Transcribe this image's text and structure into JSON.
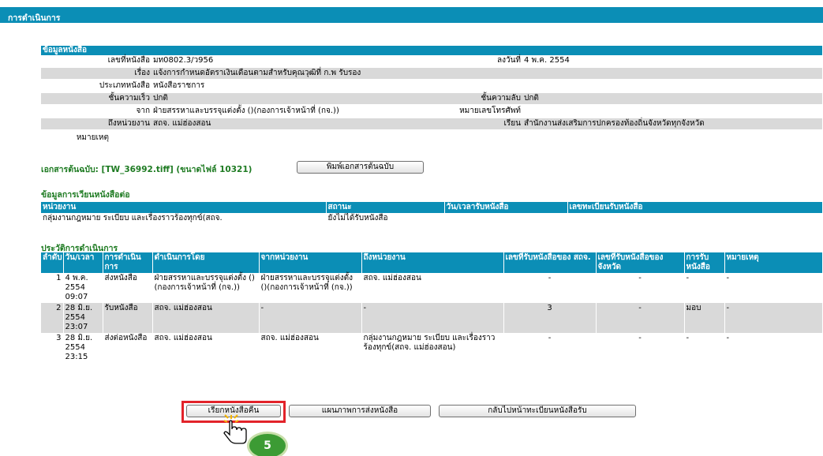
{
  "header": {
    "title": "การดำเนินการ"
  },
  "doc_info": {
    "section_title": "ข้อมูลหนังสือ",
    "number_label": "เลขที่หนังสือ",
    "number_value": "มท0802.3/ว956",
    "date_label": "ลงวันที่",
    "date_value": "4 พ.ค. 2554",
    "subject_label": "เรื่อง",
    "subject_value": "แจ้งการกำหนดอัตราเงินเดือนตามสำหรับคุณวุฒิที่ ก.พ รับรอง",
    "type_label": "ประเภทหนังสือ",
    "type_value": "หนังสือราชการ",
    "urgency_label": "ชั้นความเร็ว",
    "urgency_value": "ปกติ",
    "secrecy_label": "ชั้นความลับ",
    "secrecy_value": "ปกติ",
    "from_label": "จาก",
    "from_value": "ฝ่ายสรรหาและบรรจุแต่งตั้ง ()(กองการเจ้าหน้าที่ (กจ.))",
    "phone_label": "หมายเลขโทรศัพท์",
    "phone_value": "",
    "to_label": "ถึงหน่วยงาน",
    "to_value": "สถจ. แม่ฮ่องสอน",
    "attn_label": "เรียน",
    "attn_value": "สำนักงานส่งเสริมการปกครองท้องถิ่นจังหวัดทุกจังหวัด",
    "note_label": "หมายเหตุ",
    "note_value": ""
  },
  "original_doc": {
    "text": "เอกสารต้นฉบับ: [TW_36992.tiff] (ขนาดไฟล์ 10321)",
    "print_button": "พิมพ์เอกสารต้นฉบับ"
  },
  "routing": {
    "title": "ข้อมูลการเวียนหนังสือต่อ",
    "headers": [
      "หน่วยงาน",
      "สถานะ",
      "วัน/เวลารับหนังสือ",
      "เลขทะเบียนรับหนังสือ"
    ],
    "rows": [
      [
        "กลุ่มงานกฎหมาย ระเบียบ และเรื่องราวร้องทุกข์(สถจ.",
        "ยังไม่ได้รับหนังสือ",
        "",
        ""
      ]
    ]
  },
  "history": {
    "title": "ประวัติการดำเนินการ",
    "headers": [
      "ลำดับ",
      "วัน/เวลา",
      "การดำเนินการ",
      "ดำเนินการโดย",
      "จากหน่วยงาน",
      "ถึงหน่วยงาน",
      "เลขที่รับหนังสือของ สถจ.",
      "เลขที่รับหนังสือของจังหวัด",
      "การรับหนังสือ",
      "หมายเหตุ"
    ],
    "rows": [
      [
        "1",
        "4 พ.ค. 2554 09:07",
        "ส่งหนังสือ",
        "ฝ่ายสรรหาและบรรจุแต่งตั้ง ()(กองการเจ้าหน้าที่ (กจ.))",
        "ฝ่ายสรรหาและบรรจุแต่งตั้ง ()(กองการเจ้าหน้าที่ (กจ.))",
        "สถจ. แม่ฮ่องสอน",
        "-",
        "-",
        "-",
        "-"
      ],
      [
        "2",
        "28 มิ.ย. 2554 23:07",
        "รับหนังสือ",
        "สถจ. แม่ฮ่องสอน",
        "-",
        "-",
        "3",
        "-",
        "มอบ",
        "-"
      ],
      [
        "3",
        "28 มิ.ย. 2554 23:15",
        "ส่งต่อหนังสือ",
        "สถจ. แม่ฮ่องสอน",
        "สถจ. แม่ฮ่องสอน",
        "กลุ่มงานกฎหมาย ระเบียบ และเรื่องราวร้องทุกข์(สถจ. แม่ฮ่องสอน)",
        "-",
        "-",
        "-",
        "-"
      ]
    ]
  },
  "actions": {
    "recall": "เรียกหนังสือคืน",
    "route_map": "แผนภาพการส่งหนังสือ",
    "back": "กลับไปหน้าทะเบียนหนังสือรับ"
  },
  "step_badge": "5",
  "colors": {
    "header_blue": "#0b8eb6",
    "section_green": "#1e7b22",
    "highlight_red": "#e2232a",
    "badge_green": "#3c9b34"
  }
}
